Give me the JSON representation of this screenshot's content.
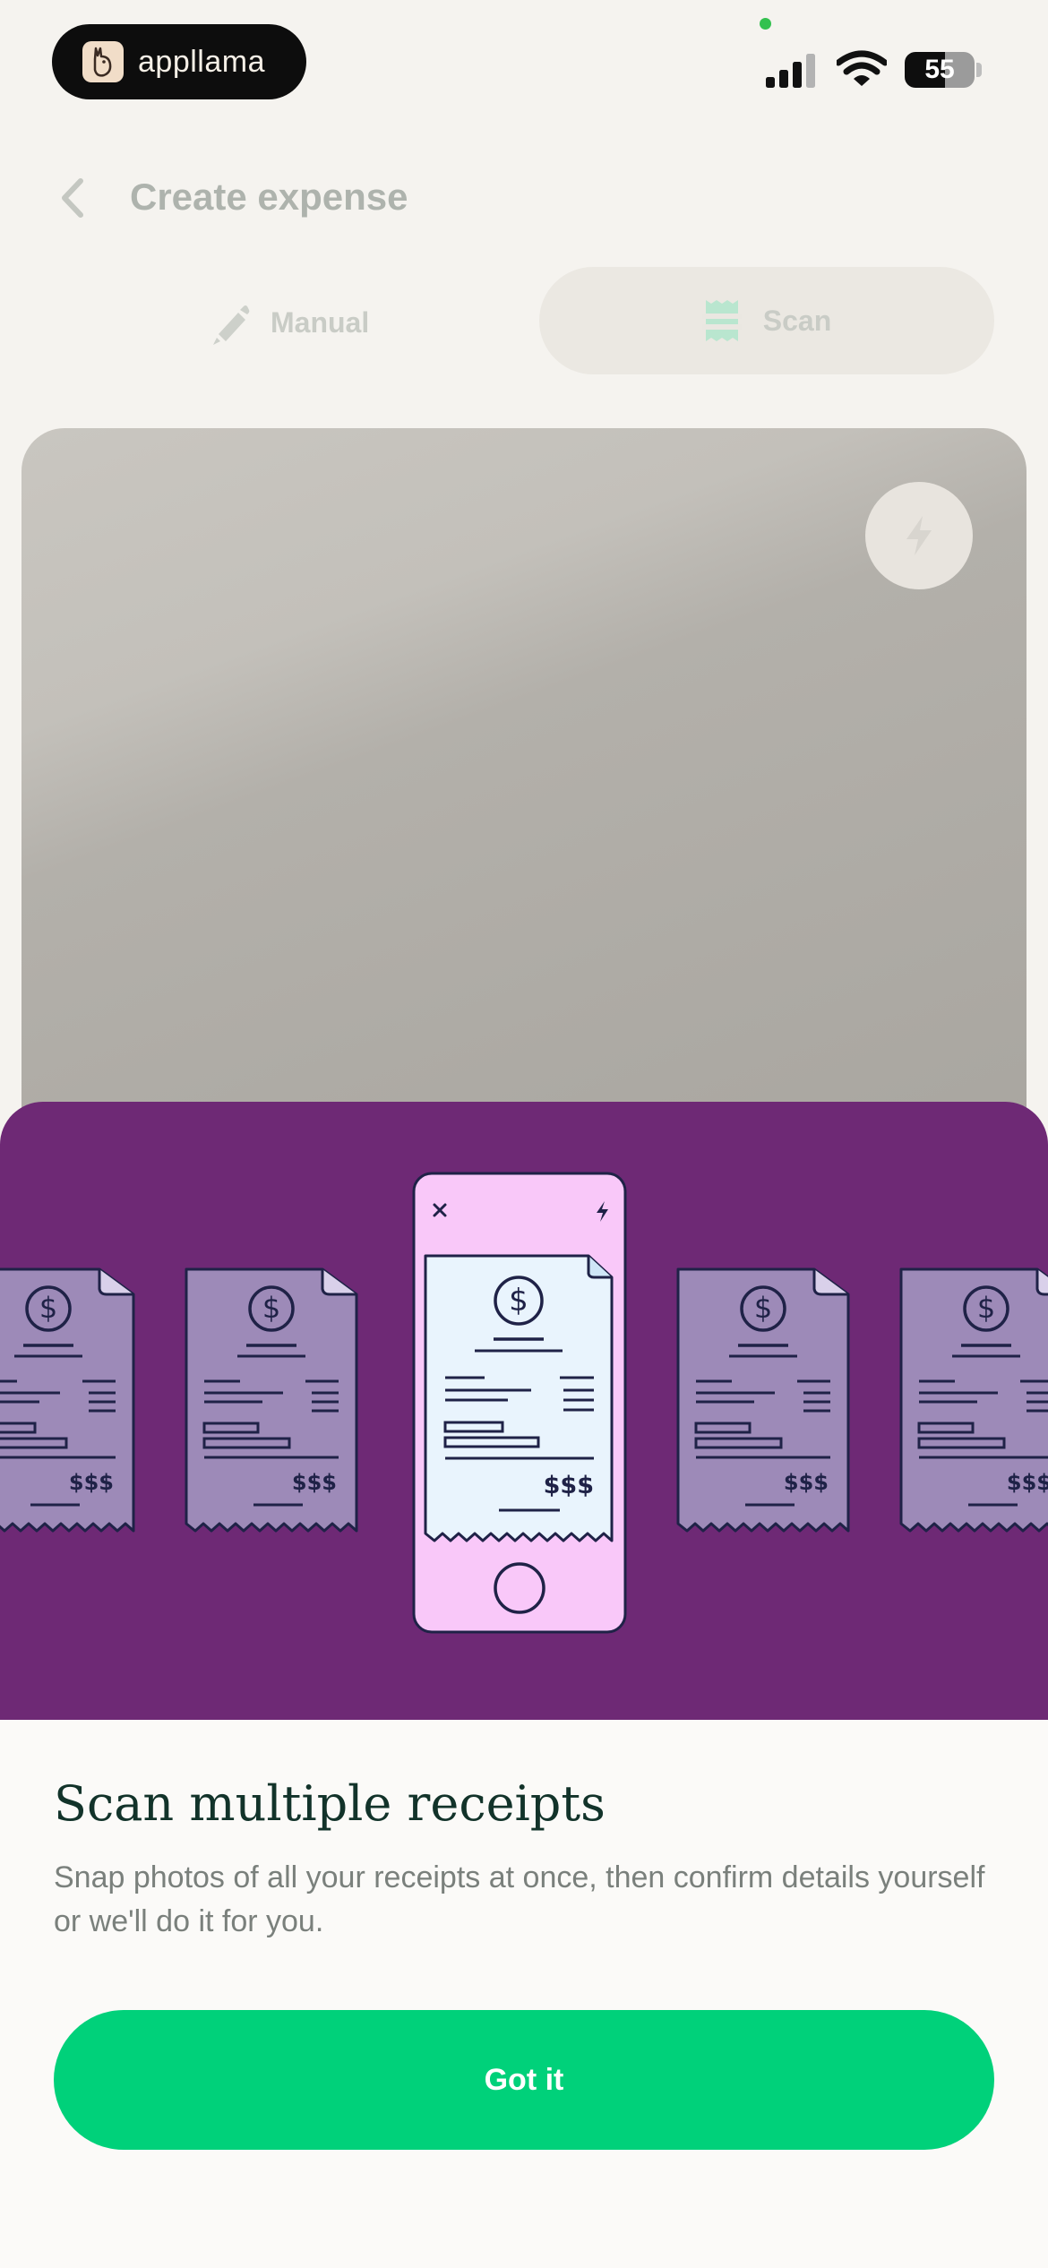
{
  "status_bar": {
    "app_name": "appllama",
    "battery": "55",
    "icons": [
      "signal-icon",
      "wifi-icon",
      "battery-icon"
    ]
  },
  "header": {
    "title": "Create expense",
    "back_icon": "chevron-left-icon"
  },
  "mode_tabs": {
    "manual_label": "Manual",
    "scan_label": "Scan",
    "selected": "Scan"
  },
  "camera": {
    "flash_icon": "lightning-icon"
  },
  "illustration": {
    "receipt_amount": "$$$",
    "currency_symbol": "$"
  },
  "onboarding": {
    "title": "Scan multiple receipts",
    "body": "Snap photos of all your receipts at once, then confirm details yourself or we'll do it for you.",
    "button_label": "Got it"
  },
  "colors": {
    "accent_green": "#00d17a",
    "illustration_bg": "#6e2975",
    "title_text": "#12332a"
  }
}
